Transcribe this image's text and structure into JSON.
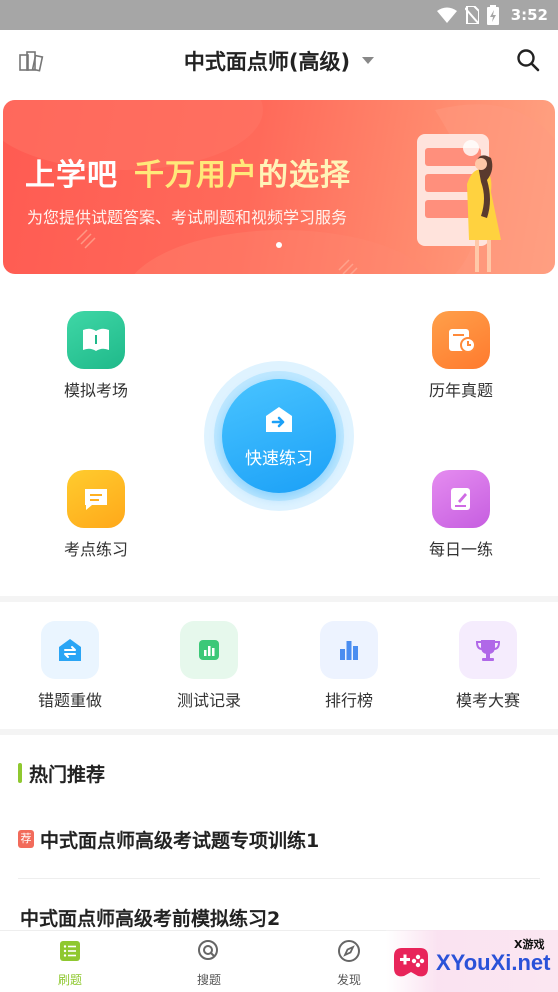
{
  "status_bar": {
    "time": "3:52"
  },
  "header": {
    "title": "中式面点师(高级)"
  },
  "banner": {
    "brand": "上学吧",
    "slogan_part1": "千万用户",
    "slogan_part2": "的选择",
    "subtitle": "为您提供试题答案、考试刷题和视频学习服务"
  },
  "main_grid": {
    "mock_exam": "模拟考场",
    "past_papers": "历年真题",
    "key_points": "考点练习",
    "daily": "每日一练",
    "quick_practice": "快速练习"
  },
  "tools": {
    "wrong_redo": "错题重做",
    "test_records": "测试记录",
    "ranking": "排行榜",
    "mock_contest": "模考大赛"
  },
  "hot": {
    "title": "热门推荐",
    "tag": "荐",
    "items": [
      "中式面点师高级考试题专项训练1",
      "中式面点师高级考前模拟练习2"
    ]
  },
  "bottom_nav": [
    "刷题",
    "搜题",
    "发现"
  ],
  "watermark": {
    "brand": "XYouXi.net",
    "small": "X游戏"
  },
  "colors": {
    "accent_green": "#8fc830",
    "banner_red": "#ff5b52",
    "quick_blue": "#1ba0f7"
  }
}
